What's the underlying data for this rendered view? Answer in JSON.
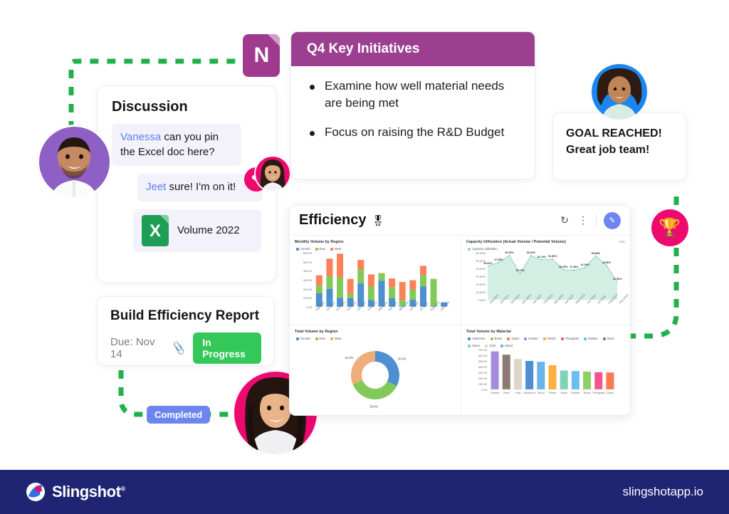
{
  "onenote": {
    "icon": "onenote-icon",
    "letter": "N"
  },
  "q4_card": {
    "title": "Q4 Key Initiatives",
    "items": [
      "Examine how well material needs are being met",
      "Focus on raising the R&D Budget"
    ]
  },
  "discussion": {
    "title": "Discussion",
    "messages": [
      {
        "mention": "Vanessa",
        "text": " can you pin the Excel doc here?"
      },
      {
        "mention": "Jeet",
        "text": " sure! I'm on it!"
      }
    ],
    "attachment": {
      "name": "Volume 2022",
      "file_type": "excel",
      "icon_letter": "X"
    },
    "reaction_icon": "heart-icon"
  },
  "task_card": {
    "title": "Build Efficiency Report",
    "due": "Due: Nov 14",
    "attachment_icon": "paperclip-icon",
    "status": "In Progress",
    "status_color": "#34c759"
  },
  "completed_badge": {
    "label": "Completed",
    "color": "#6d86ef"
  },
  "goal_card": {
    "line1": "GOAL REACHED!",
    "line2": "Great job team!"
  },
  "trophy_badge": {
    "icon": "trophy-icon",
    "color": "#ec0a6e"
  },
  "dashboard": {
    "title": "Efficiency",
    "title_badge_icon": "ribbon-award-icon",
    "tools": [
      {
        "name": "refresh-icon",
        "glyph": "↻"
      },
      {
        "name": "more-options-icon",
        "glyph": "⋮"
      },
      {
        "name": "edit-pencil-icon",
        "glyph": "✎"
      }
    ]
  },
  "chart_data": [
    {
      "type": "bar",
      "title": "Monthly Volume by Region",
      "stacked": true,
      "categories": [
        "Sep 2021",
        "Oct 2021",
        "Nov 2021",
        "Dec 2021",
        "Jan 2022",
        "Feb 2022",
        "Mar 2022",
        "Apr 2022",
        "May 2022",
        "Jun 2022",
        "Jul 2022",
        "Aug 2022",
        "Sep 2022"
      ],
      "series": [
        {
          "name": "Central",
          "color": "#4d8fd1",
          "values": [
            150,
            200,
            100,
            95,
            260,
            75,
            290,
            95,
            10,
            80,
            225,
            10,
            50
          ]
        },
        {
          "name": "East",
          "color": "#82c95a",
          "values": [
            85,
            140,
            225,
            50,
            155,
            150,
            80,
            120,
            65,
            110,
            130,
            300,
            0
          ]
        },
        {
          "name": "West",
          "color": "#fa8258",
          "values": [
            115,
            195,
            265,
            165,
            105,
            135,
            5,
            100,
            200,
            105,
            100,
            0,
            0
          ]
        }
      ],
      "ylabel": "",
      "xlabel": "",
      "yticks": [
        "0.00",
        "100.00",
        "200.00",
        "300.00",
        "400.00",
        "500.00",
        "600.00"
      ],
      "ylim": [
        0,
        600
      ],
      "grid": false,
      "legend_position": "top-left"
    },
    {
      "type": "area",
      "title": "Capacity Utilization (Actual Volume / Potential Volume)",
      "series_name": "Capacity Utilization",
      "color": "#8fd9c0",
      "categories": [
        "Sep 2021",
        "Oct 2021",
        "Nov 2021",
        "Dec 2021",
        "Jan 2022",
        "Feb 2022",
        "Mar 2022",
        "Apr 2022",
        "May 2022",
        "Jun 2022",
        "Jul 2022",
        "Aug 2022",
        "Sep 2022"
      ],
      "values": [
        43.0,
        47.55,
        56.5,
        33.79,
        56.2,
        51.14,
        51.86,
        38.25,
        37.86,
        41.0,
        55.88,
        43.86,
        22.5
      ],
      "labels": [
        "43.00%",
        "47.55%",
        "56.50%",
        "33.79%",
        "56.20%",
        "51.14%",
        "51.86%",
        "38.25%",
        "37.86%",
        "41.00%",
        "55.88%",
        "43.86%",
        "22.50%"
      ],
      "yticks": [
        "0.00%",
        "10.00%",
        "20.00%",
        "30.00%",
        "40.00%",
        "50.00%",
        "60.00%"
      ],
      "ylim": [
        0,
        60
      ],
      "grid": false,
      "legend_position": "top-left"
    },
    {
      "type": "pie",
      "title": "Total Volume by Region",
      "donut": true,
      "labels": [
        "Central",
        "East",
        "West"
      ],
      "values": [
        32.4,
        36.4,
        31.2
      ],
      "display_labels": [
        "32.4%",
        "36.4%",
        "31.2%"
      ],
      "colors": [
        "#4d8fd1",
        "#82c95a",
        "#edad7c"
      ],
      "legend_position": "top-left"
    },
    {
      "type": "bar",
      "title": "Total Volume by Material",
      "categories": [
        "Granite",
        "Steel",
        "Vinyl",
        "Aluminum",
        "Wood",
        "Plastic",
        "Stone",
        "Rubber",
        "Brass",
        "Plexiglass",
        "Glass"
      ],
      "values": [
        668,
        610,
        535,
        500,
        485,
        425,
        332,
        322,
        312,
        302,
        298
      ],
      "colors": [
        "#a78bdb",
        "#8d7a73",
        "#ddd6c8",
        "#4d8fd1",
        "#69b3ea",
        "#fbb040",
        "#7fd3b8",
        "#6ebdf0",
        "#8ece64",
        "#f4538f",
        "#fa7a52"
      ],
      "legend": [
        "Aluminum",
        "Brass",
        "Glass",
        "Granite",
        "Plastic",
        "Plexiglass",
        "Rubber",
        "Steel",
        "Stone",
        "Vinyl",
        "Wood"
      ],
      "legend_colors": [
        "#4d8fd1",
        "#8ece64",
        "#fa7a52",
        "#a78bdb",
        "#fbb040",
        "#f4538f",
        "#6ebdf0",
        "#8d7a73",
        "#7fd3b8",
        "#ddd6c8",
        "#69b3ea"
      ],
      "yticks": [
        "0.00",
        "100.00",
        "200.00",
        "300.00",
        "400.00",
        "500.00",
        "600.00",
        "700.00"
      ],
      "ylim": [
        0,
        700
      ],
      "grid": false,
      "legend_position": "top"
    }
  ],
  "avatars": [
    {
      "name": "avatar-jeet",
      "ring": "#8e5fc4"
    },
    {
      "name": "avatar-vanessa",
      "ring": "#ec0a6e"
    },
    {
      "name": "avatar-team-member",
      "ring": "#1a87f0"
    },
    {
      "name": "avatar-designer",
      "ring": "#ec0a6e"
    }
  ],
  "footer": {
    "brand": "Slingshot",
    "trademark": "®",
    "url": "slingshotapp.io",
    "bg": "#1f2573"
  }
}
